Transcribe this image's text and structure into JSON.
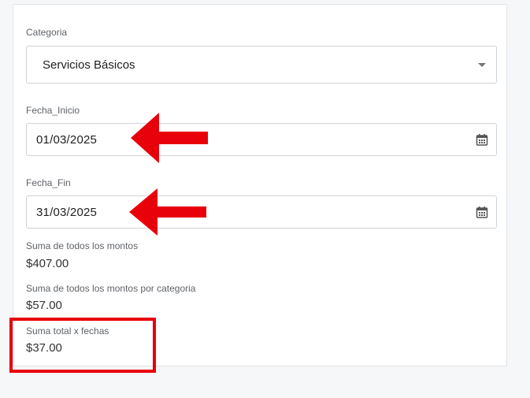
{
  "form": {
    "categoria": {
      "label": "Categoria",
      "selected": "Servicios Básicos"
    },
    "fecha_inicio": {
      "label": "Fecha_Inicio",
      "value": "01/03/2025"
    },
    "fecha_fin": {
      "label": "Fecha_Fin",
      "value": "31/03/2025"
    }
  },
  "summary": {
    "total": {
      "label": "Suma de todos los montos",
      "value": "$407.00"
    },
    "por_categoria": {
      "label": "Suma de todos los montos por categoria",
      "value": "$57.00"
    },
    "por_fechas": {
      "label": "Suma total x fechas",
      "value": "$37.00"
    }
  },
  "annotations": {
    "color": "#e8000b"
  },
  "icons": [
    "chevron-down-icon",
    "calendar-icon",
    "arrow-left-icon"
  ]
}
